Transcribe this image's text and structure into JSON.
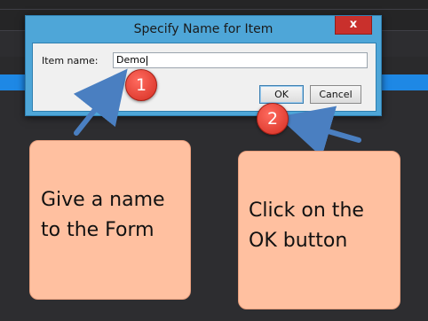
{
  "dialog": {
    "title": "Specify Name for Item",
    "close_label": "x",
    "item_label": "Item name:",
    "item_value": "Demo",
    "ok_label": "OK",
    "cancel_label": "Cancel"
  },
  "steps": [
    {
      "number": "1",
      "note": "Give a name\nto the Form"
    },
    {
      "number": "2",
      "note": "Click on the\nOK button"
    }
  ],
  "colors": {
    "dialog_frame": "#4ea6d8",
    "badge": "#d52e22",
    "note": "#ffc0a0",
    "arrow": "#4a7fc1"
  }
}
